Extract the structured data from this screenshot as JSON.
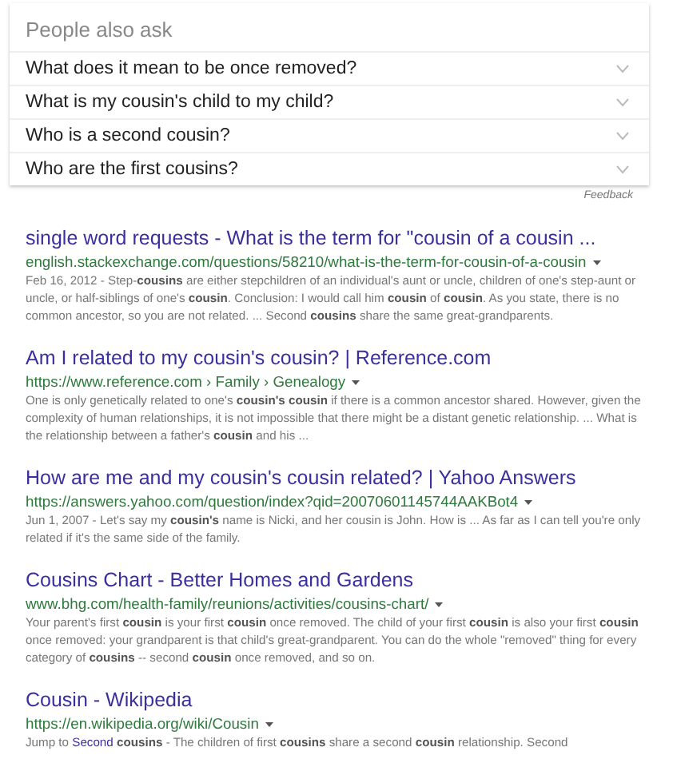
{
  "people_also_ask": {
    "heading": "People also ask",
    "questions": [
      {
        "text": "What does it mean to be once removed?",
        "expanded": false
      },
      {
        "text": "What is my cousin's child to my child?",
        "expanded": false
      },
      {
        "text": "Who is a second cousin?",
        "expanded": false
      },
      {
        "text": "Who are the first cousins?",
        "expanded": false
      }
    ],
    "feedback": "Feedback"
  },
  "results": [
    {
      "title": "single word requests - What is the term for \"cousin of a cousin ...",
      "url": "english.stackexchange.com/questions/58210/what-is-the-term-for-cousin-of-a-cousin",
      "snippet": "Feb 16, 2012 - Step-**cousins** are either stepchildren of an individual's aunt or uncle, children of one's step-aunt or uncle, or half-siblings of one's **cousin**. Conclusion: I would call him **cousin** of **cousin**. As you state, there is no common ancestor, so you are not related. ... Second **cousins** share the same great-grandparents."
    },
    {
      "title": "Am I related to my cousin's cousin? | Reference.com",
      "url": "https://www.reference.com › Family › Genealogy",
      "snippet": "One is only genetically related to one's **cousin's cousin** if there is a common ancestor shared. However, given the complexity of human relationships, it is not impossible that there might be a distant genetic relationship. ... What is the relationship between a father's **cousin** and his ..."
    },
    {
      "title": "How are me and my cousin's cousin related? | Yahoo Answers",
      "url": "https://answers.yahoo.com/question/index?qid=20070601145744AAKBot4",
      "snippet": "Jun 1, 2007 - Let's say my **cousin's** name is Nicki, and her cousin is John. How is ... As far as I can tell you're only related if it's the same side of the family."
    },
    {
      "title": "Cousins Chart - Better Homes and Gardens",
      "url": "www.bhg.com/health-family/reunions/activities/cousins-chart/",
      "snippet": "Your parent's first **cousin** is your first **cousin** once removed. The child of your first **cousin** is also your first **cousin** once removed: your grandparent is that child's great-grandparent. You can do the whole \"removed\" thing for every category of **cousins** -- second **cousin** once removed, and so on."
    },
    {
      "title": "Cousin - Wikipedia",
      "url": "https://en.wikipedia.org/wiki/Cousin",
      "jump_prefix": "Jump to",
      "jump_link": "Second **cousins**",
      "snippet": " - The children of first **cousins** share a second **cousin** relationship. Second"
    }
  ]
}
